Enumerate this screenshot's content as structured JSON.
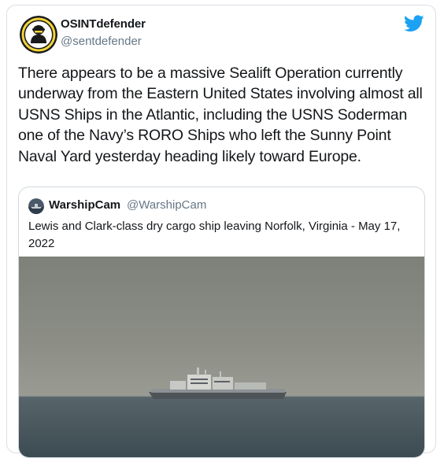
{
  "tweet": {
    "author_name": "OSINTdefender",
    "author_handle": "@sentdefender",
    "text": "There appears to be a massive Sealift Operation currently underway from the Eastern United States involving almost all USNS Ships in the Atlantic, including the USNS Soderman one of the Navy’s RORO Ships who left the Sunny Point Naval Yard yesterday heading likely toward Europe.",
    "avatar_icon": "soldier-silhouette-avatar",
    "platform_icon": "twitter-bird-icon"
  },
  "quoted_tweet": {
    "author_name": "WarshipCam",
    "author_handle": "@WarshipCam",
    "text": "Lewis and Clark-class dry cargo ship leaving Norfolk, Virginia - May 17, 2022",
    "media_icon": "cargo-ship-at-sea-photo"
  },
  "colors": {
    "twitter_blue": "#1da1f2",
    "text_primary": "#14171a",
    "text_secondary": "#657786",
    "border": "#cfd9de"
  }
}
